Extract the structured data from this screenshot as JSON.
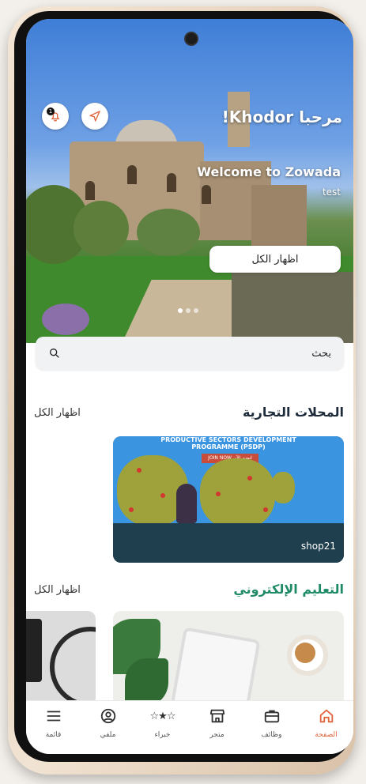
{
  "header": {
    "greeting": "مرحبا Khodor!",
    "welcome": "Welcome to Zowada",
    "subtitle": "test",
    "notification_count": "1",
    "show_all": "اظهار الكل"
  },
  "search": {
    "placeholder": "بحث"
  },
  "sections": {
    "shops": {
      "title": "المحلات التجارية",
      "show_all": "اظهار الكل",
      "card": {
        "name": "shop21",
        "banner_line1": "PRODUCTIVE SECTORS DEVELOPMENT",
        "banner_line2": "PROGRAMME (PSDP)",
        "join_label": "JOIN NOW انضم الآن"
      }
    },
    "elearning": {
      "title": "التعليم الإلكتروني",
      "show_all": "اظهار الكل"
    }
  },
  "tabs": [
    {
      "label": "الصفحة",
      "icon": "home-icon",
      "active": true
    },
    {
      "label": "وظائف",
      "icon": "briefcase-icon",
      "active": false
    },
    {
      "label": "متجر",
      "icon": "store-icon",
      "active": false
    },
    {
      "label": "خبراء",
      "icon": "stars-icon",
      "active": false
    },
    {
      "label": "ملفي",
      "icon": "user-icon",
      "active": false
    },
    {
      "label": "قائمة",
      "icon": "menu-icon",
      "active": false
    }
  ],
  "colors": {
    "accent": "#e0653f",
    "section_green": "#1f8a66",
    "card_dark": "#2f5166"
  }
}
